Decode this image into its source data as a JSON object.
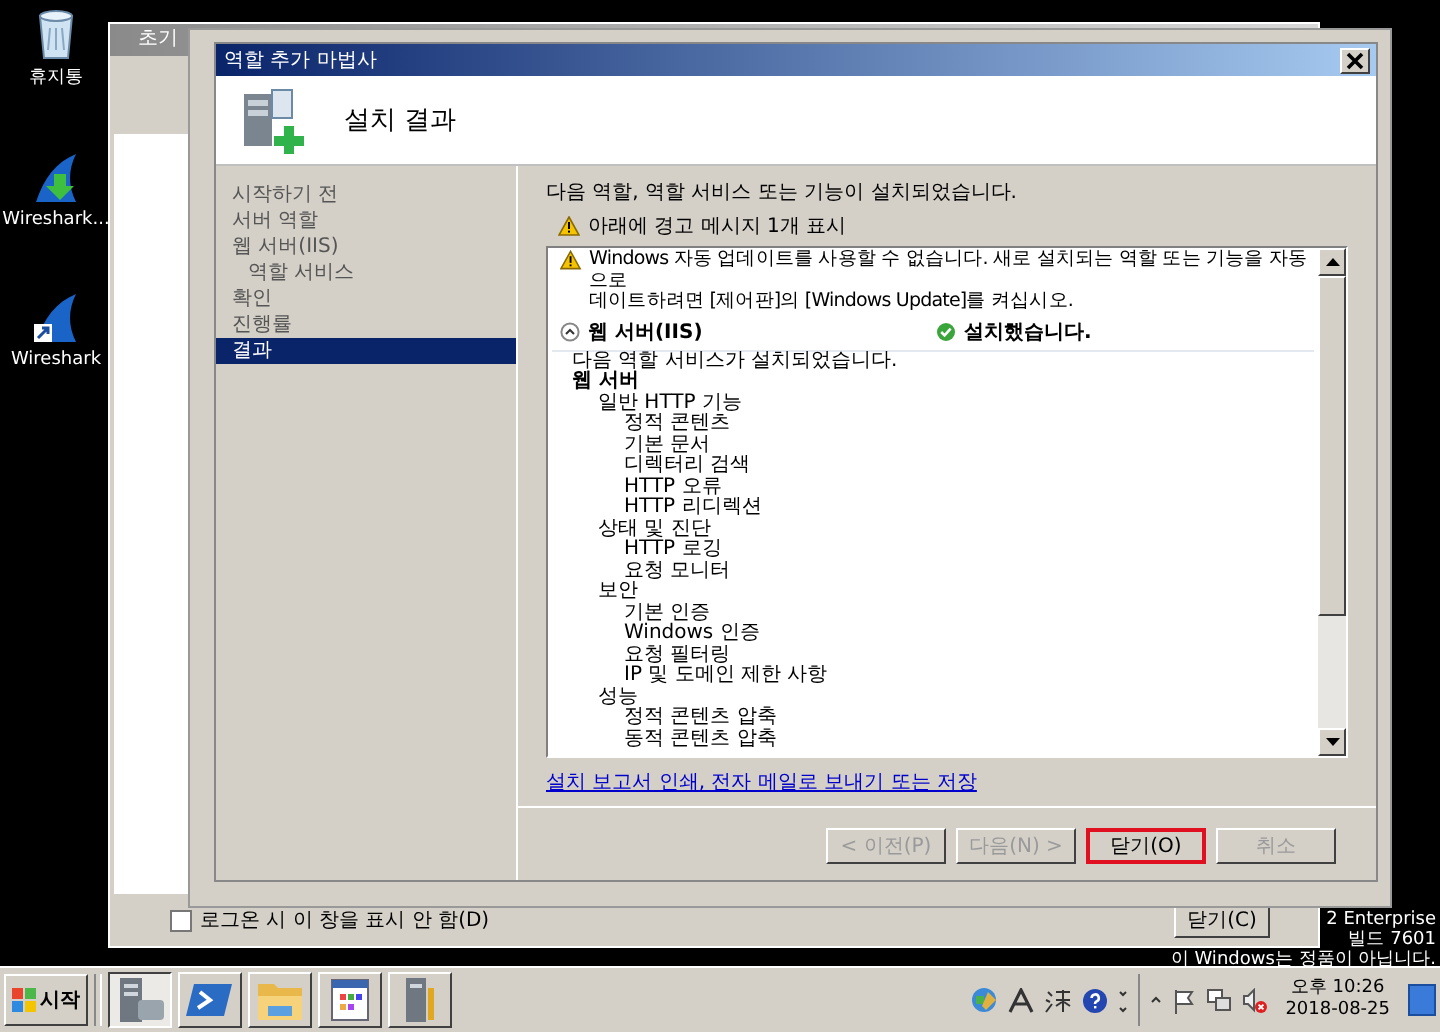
{
  "desktop_icons": [
    {
      "label": "휴지통",
      "kind": "recycle-bin"
    },
    {
      "label": "Wireshark...",
      "kind": "shark-download"
    },
    {
      "label": "Wireshark",
      "kind": "shark-shortcut"
    }
  ],
  "back_window": {
    "title": "초기",
    "checkbox": {
      "label": "로그온 시 이 창을 표시 안 함(D)",
      "checked": false
    },
    "close_button": "닫기(C)"
  },
  "wizard": {
    "title": "역할 추가 마법사",
    "heading": "설치 결과",
    "steps": [
      {
        "label": "시작하기 전",
        "selected": false
      },
      {
        "label": "서버 역할",
        "selected": false
      },
      {
        "label": "웹 서버(IIS)",
        "selected": false,
        "children": [
          {
            "label": "역할 서비스",
            "selected": false
          }
        ]
      },
      {
        "label": "확인",
        "selected": false
      },
      {
        "label": "진행률",
        "selected": false
      },
      {
        "label": "결과",
        "selected": true
      }
    ],
    "intro": "다음 역할, 역할 서비스 또는 기능이 설치되었습니다.",
    "warning_summary": "아래에 경고 메시지 1개 표시",
    "warning_lines": [
      "Windows 자동 업데이트를 사용할 수 없습니다. 새로 설치되는 역할 또는 기능을 자동으로",
      "데이트하려면 [제어판]의 [Windows Update]를 켜십시오."
    ],
    "section": {
      "title": "웹 서버(IIS)",
      "expanded": true,
      "status": "설치했습니다.",
      "note": "다음 역할 서비스가 설치되었습니다.",
      "tree": [
        {
          "label": "웹 서버",
          "children": [
            {
              "label": "일반 HTTP 기능",
              "children": [
                {
                  "label": "정적 콘텐츠"
                },
                {
                  "label": "기본 문서"
                },
                {
                  "label": "디렉터리 검색"
                },
                {
                  "label": "HTTP 오류"
                },
                {
                  "label": "HTTP 리디렉션"
                }
              ]
            },
            {
              "label": "상태 및 진단",
              "children": [
                {
                  "label": "HTTP 로깅"
                },
                {
                  "label": "요청 모니터"
                }
              ]
            },
            {
              "label": "보안",
              "children": [
                {
                  "label": "기본 인증"
                },
                {
                  "label": "Windows 인증"
                },
                {
                  "label": "요청 필터링"
                },
                {
                  "label": "IP 및 도메인 제한 사항"
                }
              ]
            },
            {
              "label": "성능",
              "children": [
                {
                  "label": "정적 콘텐츠 압축"
                },
                {
                  "label": "동적 콘텐츠 압축"
                }
              ]
            }
          ]
        }
      ]
    },
    "report_link": "설치 보고서 인쇄, 전자 메일로 보내기 또는 저장",
    "buttons": [
      {
        "label": "< 이전(P)",
        "disabled": true,
        "focused": false
      },
      {
        "label": "다음(N) >",
        "disabled": true,
        "focused": false
      },
      {
        "label": "닫기(O)",
        "disabled": false,
        "focused": true
      },
      {
        "label": "취소",
        "disabled": true,
        "focused": false
      }
    ]
  },
  "desktop_notice": [
    "2 Enterprise",
    "빌드 7601",
    "이 Windows는 정품이 아닙니다."
  ],
  "taskbar": {
    "start": "시작",
    "apps": [
      {
        "kind": "server-manager",
        "selected": true
      },
      {
        "kind": "powershell",
        "selected": false
      },
      {
        "kind": "folder",
        "selected": false
      },
      {
        "kind": "control-panel",
        "selected": false
      },
      {
        "kind": "server-tools",
        "selected": false
      }
    ],
    "time": "오후 10:26",
    "date": "2018-08-25"
  }
}
